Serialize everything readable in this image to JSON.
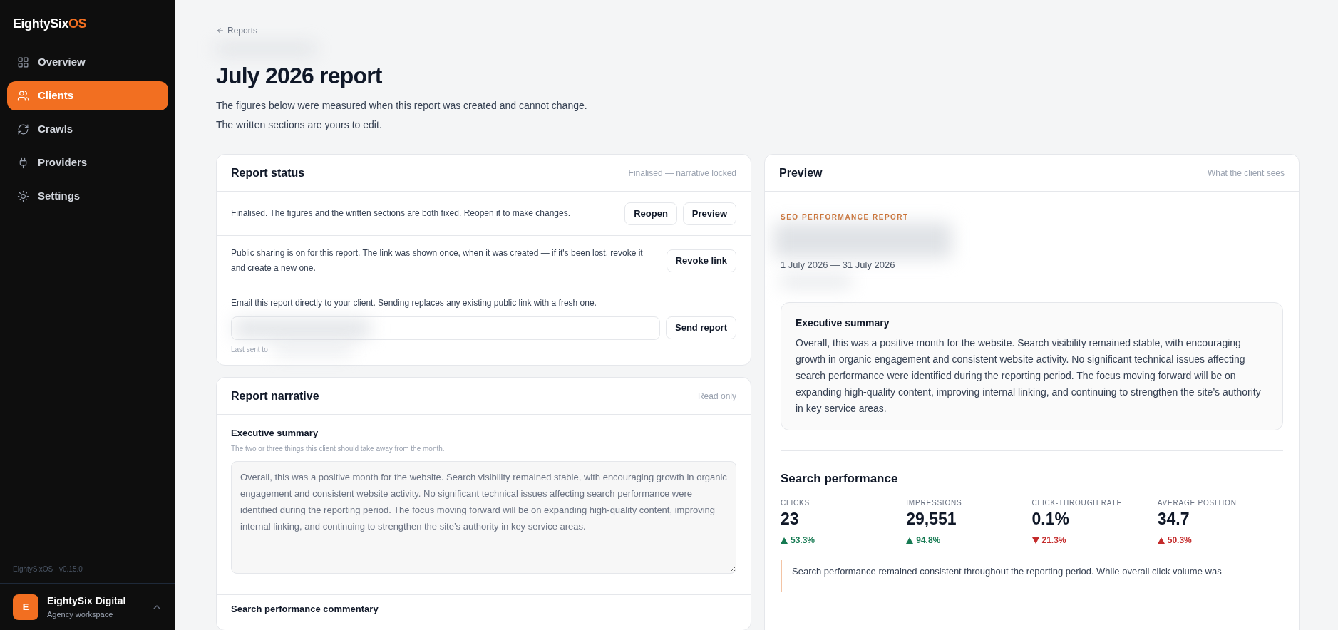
{
  "sidebar": {
    "logo": {
      "main": "EightySix",
      "accent": "OS"
    },
    "items": [
      {
        "label": "Overview",
        "selected": false
      },
      {
        "label": "Clients",
        "selected": true
      },
      {
        "label": "Crawls",
        "selected": false
      },
      {
        "label": "Providers",
        "selected": false
      },
      {
        "label": "Settings",
        "selected": false
      }
    ],
    "version": "EightySixOS · v0.15.0",
    "workspace": {
      "initial": "E",
      "name": "EightySix Digital",
      "subtitle": "Agency workspace"
    }
  },
  "breadcrumb": "Reports",
  "title": "July 2026 report",
  "intro": [
    "The figures below were measured when this report was created and cannot change.",
    "The written sections are yours to edit."
  ],
  "status_card": {
    "title": "Report status",
    "note": "Finalised — narrative locked",
    "rows": [
      {
        "text": "Finalised. The figures and the written sections are both fixed. Reopen it to make changes.",
        "buttons": [
          "Reopen",
          "Preview"
        ]
      },
      {
        "text": "Public sharing is on for this report. The link was shown once, when it was created — if it's been lost, revoke it and create a new one.",
        "buttons": [
          "Revoke link"
        ]
      }
    ],
    "email": {
      "text": "Email this report directly to your client. Sending replaces any existing public link with a fresh one.",
      "button": "Send report",
      "last_sent": "Last sent to"
    }
  },
  "narrative_card": {
    "title": "Report narrative",
    "note": "Read only",
    "sections": [
      {
        "label": "Executive summary",
        "hint": "The two or three things this client should take away from the month.",
        "value": "Overall, this was a positive month for the website. Search visibility remained stable, with encouraging growth in organic engagement and consistent website activity. No significant technical issues affecting search performance were identified during the reporting period. The focus moving forward will be on expanding high-quality content, improving internal linking, and continuing to strengthen the site’s authority in key service areas."
      }
    ],
    "next_label": "Search performance commentary"
  },
  "preview_card": {
    "title": "Preview",
    "note": "What the client sees",
    "eyebrow": "SEO PERFORMANCE REPORT",
    "period": "1 July 2026 — 31 July 2026",
    "summary": {
      "title": "Executive summary",
      "text": "Overall, this was a positive month for the website. Search visibility remained stable, with encouraging growth in organic engagement and consistent website activity. No significant technical issues affecting search performance were identified during the reporting period. The focus moving forward will be on expanding high-quality content, improving internal linking, and continuing to strengthen the site’s authority in key service areas."
    },
    "section_title": "Search performance",
    "metrics": [
      {
        "label": "CLICKS",
        "value": "23",
        "change": "53.3%",
        "kind": "rise",
        "good": true
      },
      {
        "label": "IMPRESSIONS",
        "value": "29,551",
        "change": "94.8%",
        "kind": "rise",
        "good": true
      },
      {
        "label": "CLICK-THROUGH RATE",
        "value": "0.1%",
        "change": "21.3%",
        "kind": "fall",
        "good": false
      },
      {
        "label": "AVERAGE POSITION",
        "value": "34.7",
        "change": "50.3%",
        "kind": "rise",
        "good": false
      }
    ],
    "commentary": "Search performance remained consistent throughout the reporting period. While overall click volume was"
  }
}
